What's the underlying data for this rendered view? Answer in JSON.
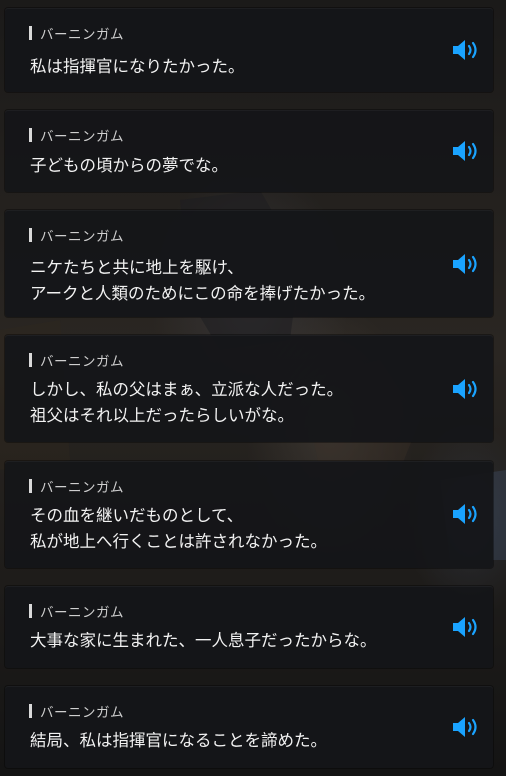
{
  "accent_color": "#1aa3ff",
  "entries": [
    {
      "speaker": "バーニンガム",
      "lines": [
        "私は指揮官になりたかった。"
      ],
      "voice_icon": "speaker-volume-icon"
    },
    {
      "speaker": "バーニンガム",
      "lines": [
        "子どもの頃からの夢でな。"
      ],
      "voice_icon": "speaker-volume-icon"
    },
    {
      "speaker": "バーニンガム",
      "lines": [
        "ニケたちと共に地上を駆け、",
        "アークと人類のためにこの命を捧げたかった。"
      ],
      "voice_icon": "speaker-volume-icon"
    },
    {
      "speaker": "バーニンガム",
      "lines": [
        "しかし、私の父はまぁ、立派な人だった。",
        "祖父はそれ以上だったらしいがな。"
      ],
      "voice_icon": "speaker-volume-icon"
    },
    {
      "speaker": "バーニンガム",
      "lines": [
        "その血を継いだものとして、",
        "私が地上へ行くことは許されなかった。"
      ],
      "voice_icon": "speaker-volume-icon"
    },
    {
      "speaker": "バーニンガム",
      "lines": [
        "大事な家に生まれた、一人息子だったからな。"
      ],
      "voice_icon": "speaker-volume-icon"
    },
    {
      "speaker": "バーニンガム",
      "lines": [
        "結局、私は指揮官になることを諦めた。"
      ],
      "voice_icon": "speaker-volume-icon"
    }
  ]
}
